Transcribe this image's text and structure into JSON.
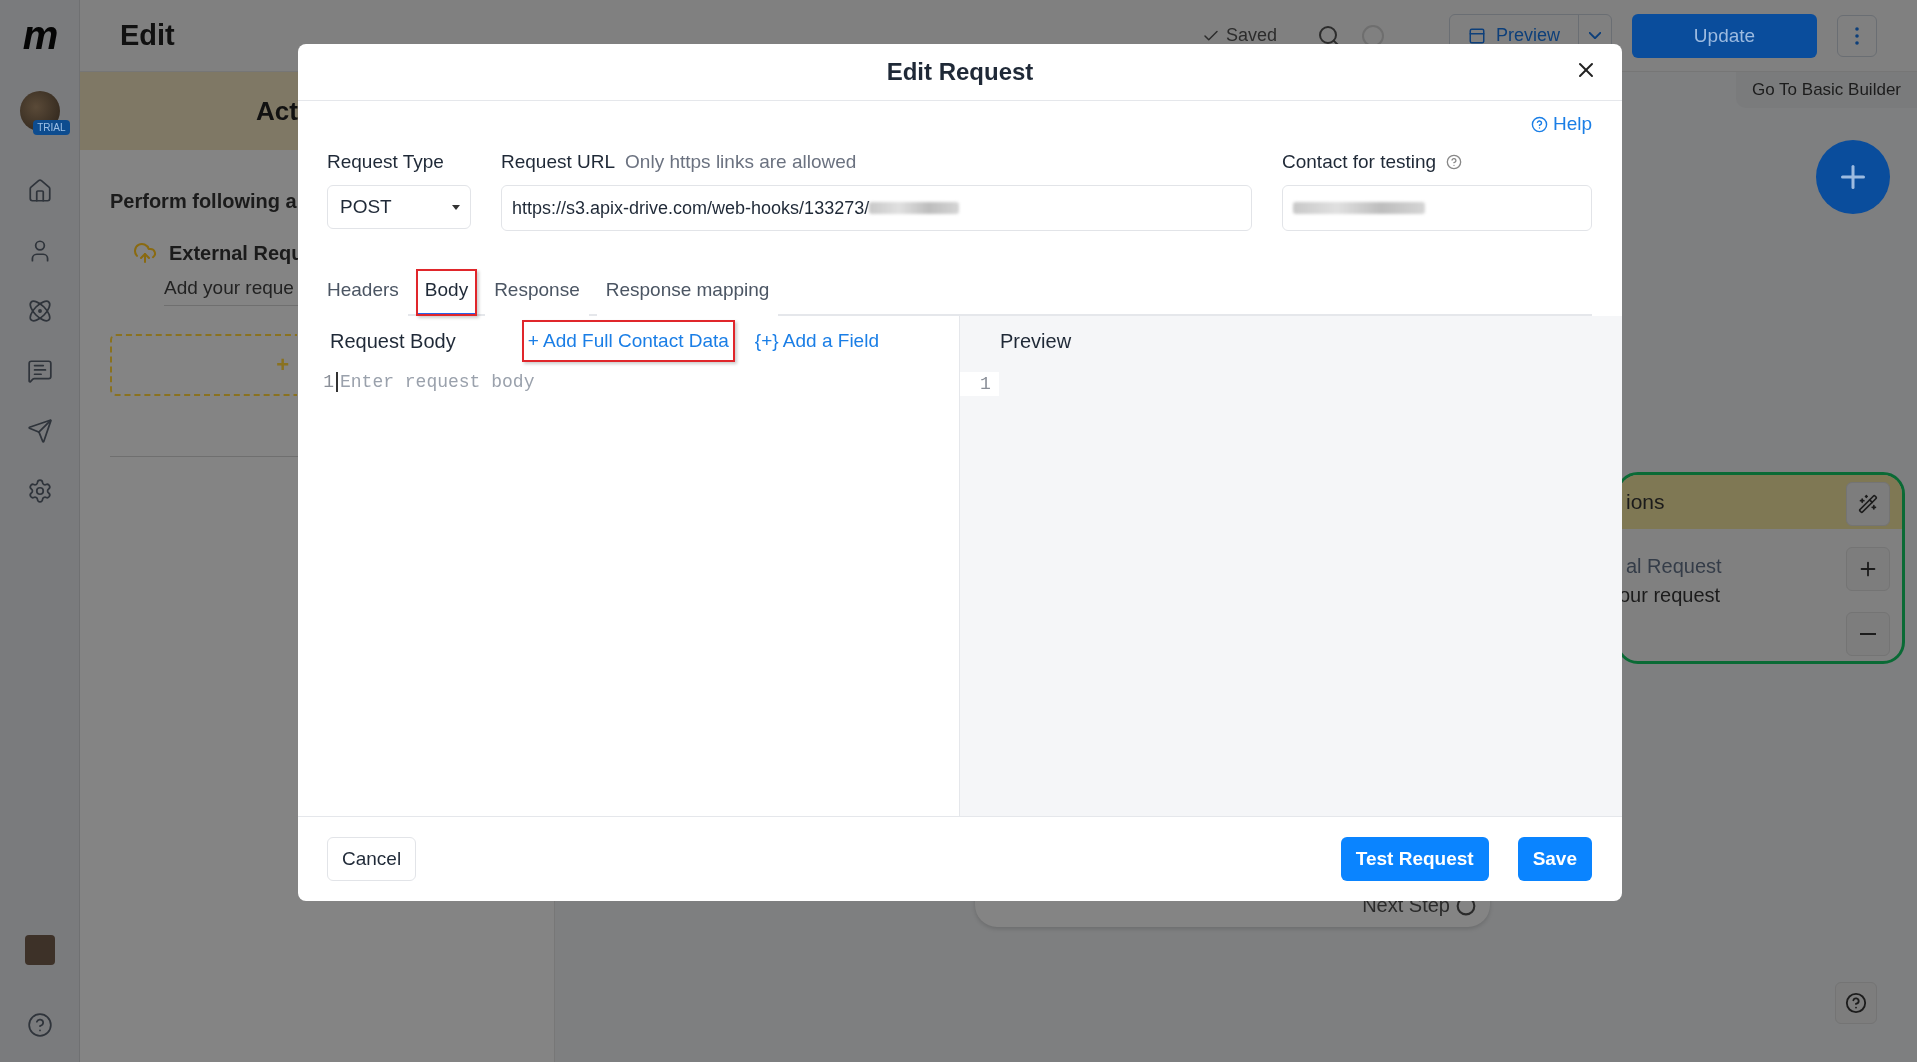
{
  "top_bar": {
    "logo": "m",
    "title": "Edit",
    "saved": "Saved",
    "preview": "Preview",
    "update": "Update"
  },
  "sidebar": {
    "avatar_badge": "TRIAL"
  },
  "left_panel": {
    "header": "Act",
    "heading": "Perform following a",
    "action_title": "External Requ",
    "action_desc": "Add your reque",
    "add_label": "+"
  },
  "canvas": {
    "basic_builder": "Go To Basic Builder",
    "card": {
      "header": "ions",
      "title": "al Request",
      "desc": "our request"
    },
    "next_step": "Next Step"
  },
  "modal": {
    "title": "Edit Request",
    "help": "Help",
    "request_type": {
      "label": "Request Type",
      "value": "POST"
    },
    "request_url": {
      "label": "Request URL",
      "hint": "Only https links are allowed",
      "value": "https://s3.apix-drive.com/web-hooks/133273/"
    },
    "contact": {
      "label": "Contact for testing"
    },
    "tabs": [
      {
        "label": "Headers",
        "selected": false,
        "highlighted": false
      },
      {
        "label": "Body",
        "selected": true,
        "highlighted": true
      },
      {
        "label": "Response",
        "selected": false,
        "highlighted": false
      },
      {
        "label": "Response mapping",
        "selected": false,
        "highlighted": false
      }
    ],
    "body": {
      "title": "Request Body",
      "actions": [
        {
          "label": "+ Add Full Contact Data",
          "highlighted": true
        },
        {
          "label": "{+} Add a Field",
          "highlighted": false
        }
      ],
      "line_number": "1",
      "placeholder": "Enter request body"
    },
    "preview": {
      "title": "Preview",
      "line_number": "1"
    },
    "buttons": {
      "cancel": "Cancel",
      "test": "Test Request",
      "save": "Save"
    }
  }
}
